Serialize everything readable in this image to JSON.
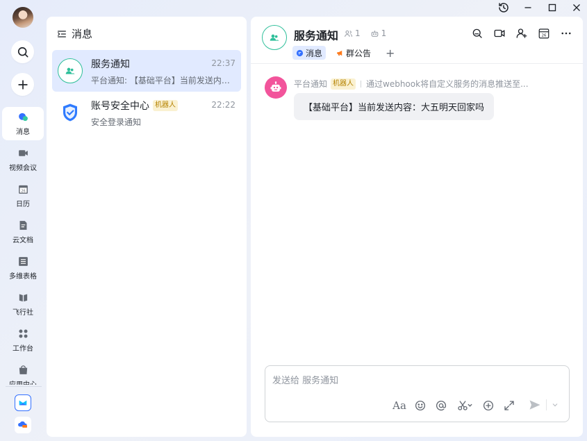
{
  "window": {
    "controls": [
      "history-icon",
      "minimize-icon",
      "maximize-icon",
      "close-icon"
    ]
  },
  "rail": {
    "items": [
      {
        "label": "消息",
        "icon": "message-icon"
      },
      {
        "label": "视频会议",
        "icon": "video-meeting-icon"
      },
      {
        "label": "日历",
        "icon": "calendar-icon"
      },
      {
        "label": "云文档",
        "icon": "cloud-doc-icon"
      },
      {
        "label": "多维表格",
        "icon": "bitable-icon"
      },
      {
        "label": "飞行社",
        "icon": "flight-club-icon"
      },
      {
        "label": "工作台",
        "icon": "workplace-icon"
      },
      {
        "label": "应用中心",
        "icon": "app-center-icon"
      }
    ]
  },
  "list": {
    "title": "消息",
    "conversations": [
      {
        "name": "服务通知",
        "time": "22:37",
        "preview": "平台通知: 【基础平台】当前发送内容：大五明天回家吗",
        "icon": "service-notification-icon"
      },
      {
        "name": "账号安全中心",
        "tag": "机器人",
        "time": "22:22",
        "preview": "安全登录通知",
        "icon": "shield-icon"
      }
    ]
  },
  "chat": {
    "title": "服务通知",
    "members": "1",
    "bots": "1",
    "tabs": {
      "messages": "消息",
      "announcement": "群公告"
    },
    "message": {
      "sender": "平台通知",
      "tag": "机器人",
      "description": "通过webhook将自定义服务的消息推送至...",
      "text": "【基础平台】当前发送内容：大五明天回家吗"
    },
    "composer": {
      "placeholder": "发送给 服务通知",
      "format_label": "Aa"
    }
  },
  "colors": {
    "accent": "#3370ff",
    "active_bg": "#e1eaff",
    "service_green": "#2ebf9a",
    "bot_pink": "#f2549b",
    "bot_tag_text": "#b58200",
    "bot_tag_bg": "#faf1d1"
  }
}
